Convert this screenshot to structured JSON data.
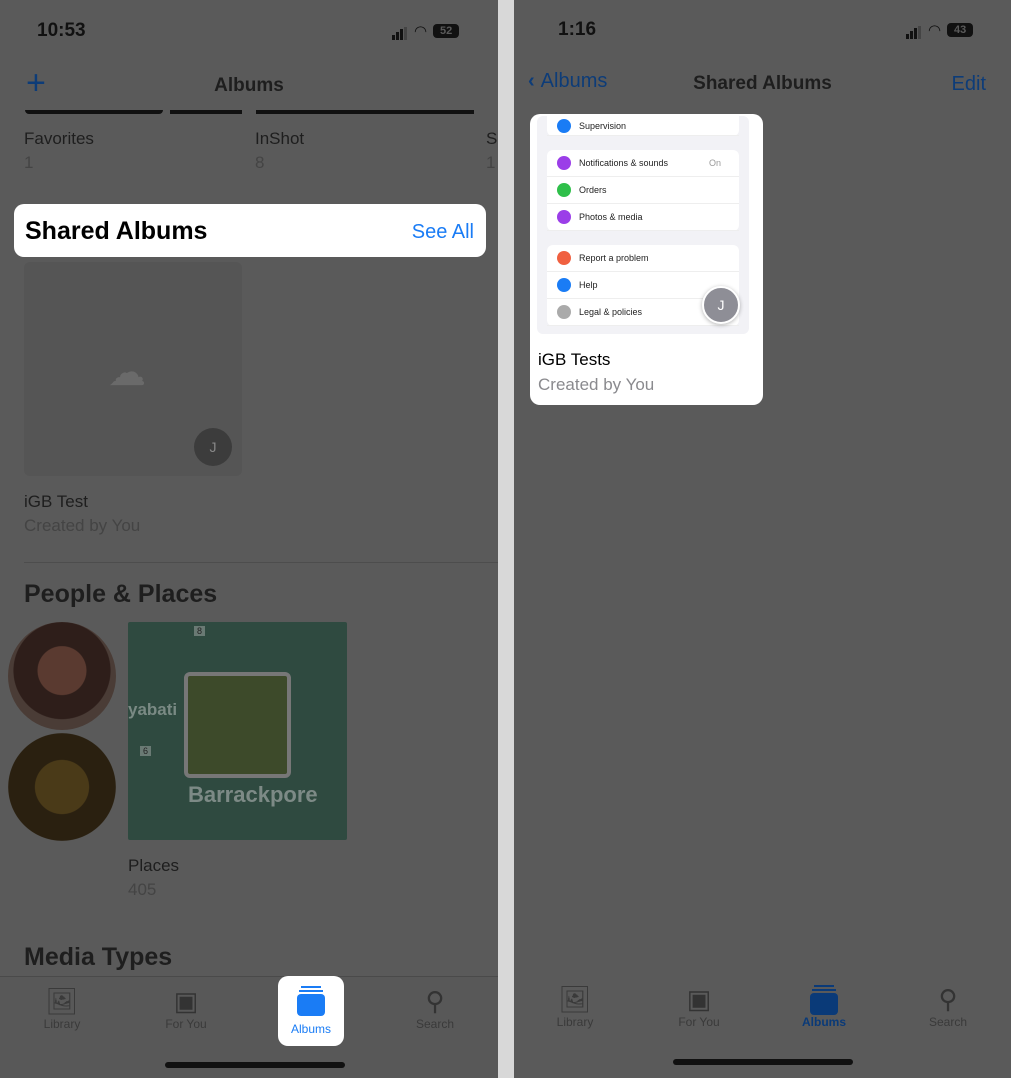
{
  "left": {
    "status": {
      "time": "10:53",
      "battery": "52"
    },
    "nav": {
      "add_icon": "plus-icon",
      "title": "Albums"
    },
    "albums": [
      {
        "name": "Favorites",
        "count": "1"
      },
      {
        "name": "InShot",
        "count": "8"
      },
      {
        "name": "S",
        "count": "1"
      }
    ],
    "shared": {
      "title": "Shared Albums",
      "see_all": "See All",
      "album_name": "iGB Test",
      "album_sub": "Created by You",
      "avatar": "J"
    },
    "people": {
      "title": "People & Places",
      "places_label": "Places",
      "places_count": "405",
      "map_label": "Barrackpore",
      "map_partial": "yabati",
      "road1": "8",
      "road2": "6"
    },
    "media_types": "Media Types",
    "tabs": [
      {
        "label": "Library",
        "icon": "photos-icon"
      },
      {
        "label": "For You",
        "icon": "for-you-icon"
      },
      {
        "label": "Albums",
        "icon": "albums-icon"
      },
      {
        "label": "Search",
        "icon": "search-icon"
      }
    ]
  },
  "right": {
    "status": {
      "time": "1:16",
      "battery": "43"
    },
    "nav": {
      "back": "Albums",
      "title": "Shared Albums",
      "edit": "Edit"
    },
    "album": {
      "name": "iGB Tests",
      "sub": "Created by You",
      "avatar": "J",
      "thumb_rows": [
        "Supervision",
        "Notifications & sounds",
        "Orders",
        "Photos & media",
        "Report a problem",
        "Help",
        "Legal & policies"
      ],
      "thumb_on": "On"
    },
    "tabs": [
      {
        "label": "Library"
      },
      {
        "label": "For You"
      },
      {
        "label": "Albums"
      },
      {
        "label": "Search"
      }
    ]
  },
  "colors": {
    "accent": "#1a7cf5",
    "dim_bg": "#5a5a5a",
    "tab_active_dim": "#0a3a78"
  }
}
